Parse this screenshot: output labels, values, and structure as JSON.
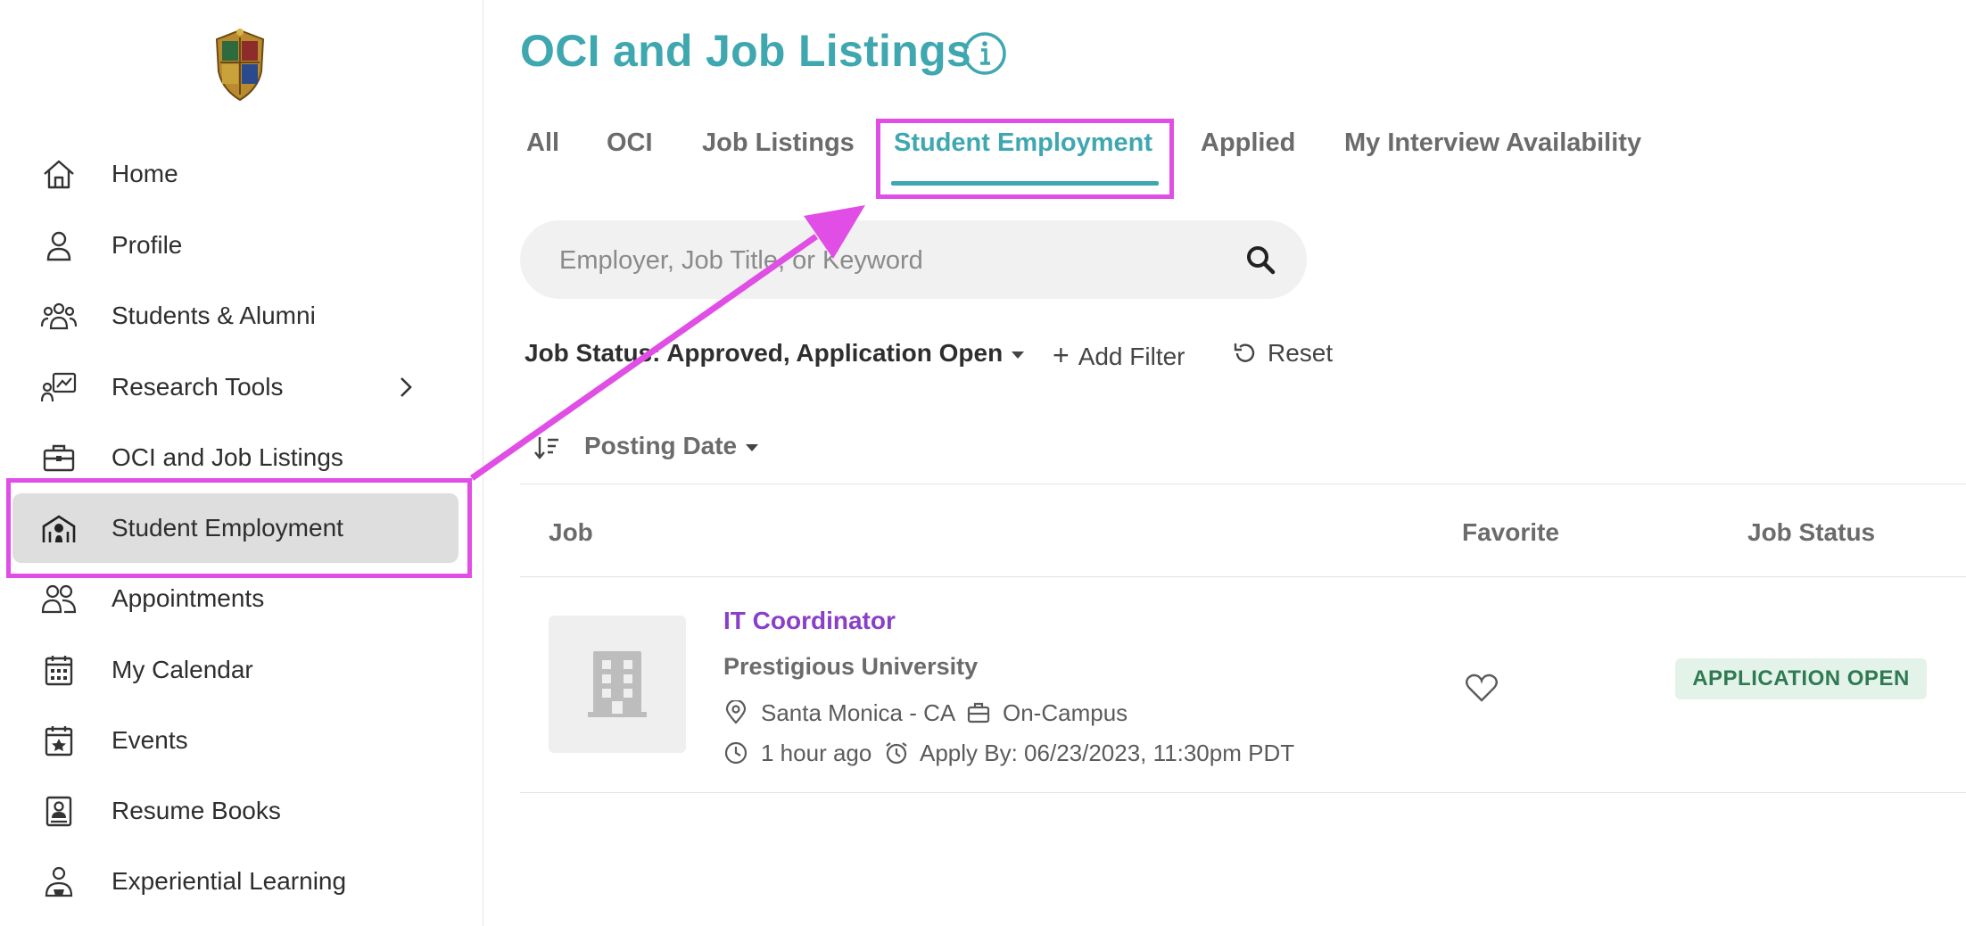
{
  "sidebar": {
    "items": [
      {
        "label": "Home",
        "icon": "home-icon"
      },
      {
        "label": "Profile",
        "icon": "person-icon"
      },
      {
        "label": "Students & Alumni",
        "icon": "group-icon"
      },
      {
        "label": "Research Tools",
        "icon": "research-icon"
      },
      {
        "label": "OCI and Job Listings",
        "icon": "briefcase-icon"
      },
      {
        "label": "Student Employment",
        "icon": "campus-building-icon"
      },
      {
        "label": "Appointments",
        "icon": "people-icon"
      },
      {
        "label": "My Calendar",
        "icon": "calendar-icon"
      },
      {
        "label": "Events",
        "icon": "event-star-icon"
      },
      {
        "label": "Resume Books",
        "icon": "resume-book-icon"
      },
      {
        "label": "Experiential Learning",
        "icon": "learner-icon"
      }
    ],
    "active_item": "Student Employment"
  },
  "header": {
    "title": "OCI and Job Listings"
  },
  "tabs": [
    {
      "label": "All"
    },
    {
      "label": "OCI"
    },
    {
      "label": "Job Listings"
    },
    {
      "label": "Student Employment"
    },
    {
      "label": "Applied"
    },
    {
      "label": "My Interview Availability"
    }
  ],
  "active_tab": "Student Employment",
  "search": {
    "placeholder": "Employer, Job Title, or Keyword",
    "value": ""
  },
  "filters": {
    "job_status_label": "Job Status: Approved, Application Open",
    "add_filter_label": "Add Filter",
    "reset_label": "Reset"
  },
  "sort": {
    "label": "Posting Date"
  },
  "table": {
    "columns": [
      "Job",
      "Favorite",
      "Job Status"
    ],
    "rows": [
      {
        "title": "IT Coordinator",
        "employer": "Prestigious University",
        "location": "Santa Monica - CA",
        "job_type": "On-Campus",
        "posted": "1 hour ago",
        "apply_by": "Apply By: 06/23/2023, 11:30pm PDT",
        "status": "APPLICATION OPEN"
      }
    ]
  },
  "colors": {
    "accent": "#3fa7b0",
    "job_title": "#8a3fc8",
    "badge_bg": "#e3f3ea",
    "badge_text": "#2f7a52",
    "annotation": "#e04ee6"
  }
}
